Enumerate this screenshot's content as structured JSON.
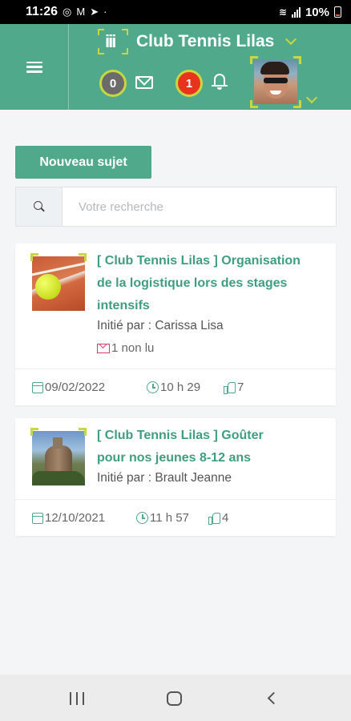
{
  "status_bar": {
    "time": "11:26",
    "left_icons": [
      "whatsapp-icon",
      "gmail-icon",
      "telegram-icon",
      "dot-icon"
    ],
    "battery": "10%"
  },
  "header": {
    "club_name": "Club Tennis Lilas",
    "messages_count": "0",
    "notifications_count": "1",
    "accent_color": "#4fa98a",
    "frame_color": "#c8d63f"
  },
  "actions": {
    "new_topic_label": "Nouveau sujet"
  },
  "search": {
    "placeholder": "Votre recherche",
    "value": ""
  },
  "topics": [
    {
      "title": "[ Club Tennis Lilas ] Organisation de la logistique lors des stages intensifs",
      "started_by": "Initié par : Carissa Lisa",
      "unread": "1 non lu",
      "date": "09/02/2022",
      "time": "10 h 29",
      "likes": "7"
    },
    {
      "title": "[ Club Tennis Lilas ] Goûter pour nos jeunes 8-12 ans",
      "started_by": "Initié par : Brault Jeanne",
      "date": "12/10/2021",
      "time": "11 h 57",
      "likes": "4"
    }
  ]
}
